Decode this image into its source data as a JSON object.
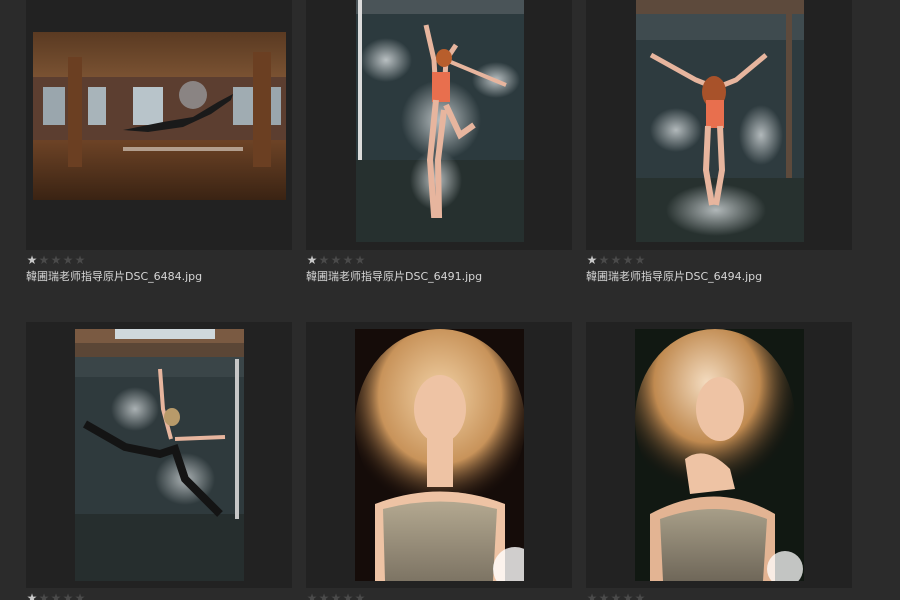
{
  "gallery": {
    "items": [
      {
        "filename": "韓圃瑞老师指导原片DSC_6484.jpg",
        "rating": 1,
        "max_rating": 5,
        "thumbnail": "dancer-leaping-in-loft"
      },
      {
        "filename": "韓圃瑞老师指导原片DSC_6491.jpg",
        "rating": 1,
        "max_rating": 5,
        "thumbnail": "dancer-in-powder-cloud"
      },
      {
        "filename": "韓圃瑞老师指导原片DSC_6494.jpg",
        "rating": 1,
        "max_rating": 5,
        "thumbnail": "dancer-arms-spread-powder"
      },
      {
        "filename": "",
        "rating": 1,
        "max_rating": 5,
        "thumbnail": "dancer-split-leap-studio"
      },
      {
        "filename": "",
        "rating": 0,
        "max_rating": 5,
        "thumbnail": "blonde-model-wind-hair"
      },
      {
        "filename": "",
        "rating": 0,
        "max_rating": 5,
        "thumbnail": "blonde-model-pose-backlit"
      }
    ],
    "star_glyph": "★"
  },
  "colors": {
    "background": "#2b2b2b",
    "cell": "#222222",
    "star_on": "#c8c8c8",
    "star_off": "#4a4a4a",
    "text": "#d6d6d6"
  }
}
